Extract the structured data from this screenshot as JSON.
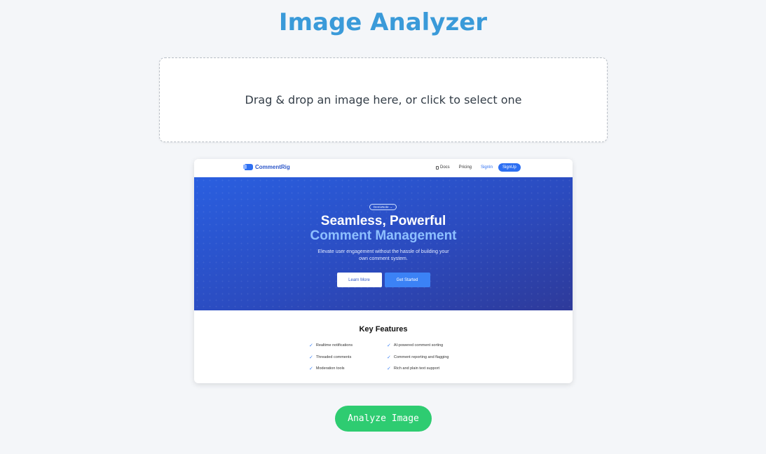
{
  "page": {
    "title": "Image Analyzer"
  },
  "dropzone": {
    "text": "Drag & drop an image here, or click to select one"
  },
  "preview": {
    "nav": {
      "logo_text": "CommentRig",
      "links": [
        "Docs",
        "Pricing",
        "SignIn"
      ],
      "signup_label": "SignUp"
    },
    "hero": {
      "pill": "DemoNote →",
      "heading_line1": "Seamless, Powerful",
      "heading_line2": "Comment Management",
      "subtitle": "Elevate user engagement without the hassle of building your own comment system.",
      "learn_more": "Learn More",
      "get_started": "Get Started"
    },
    "features": {
      "title": "Key Features",
      "items": [
        "Realtime notifications",
        "AI-powered comment sorting",
        "Threaded comments",
        "Comment reporting and flagging",
        "Moderation tools",
        "Rich and plain text support"
      ]
    }
  },
  "actions": {
    "analyze_label": "Analyze Image"
  },
  "colors": {
    "title": "#3a9ad9",
    "analyze_button": "#2ecc71",
    "hero_blue": "#2b4bbf"
  }
}
